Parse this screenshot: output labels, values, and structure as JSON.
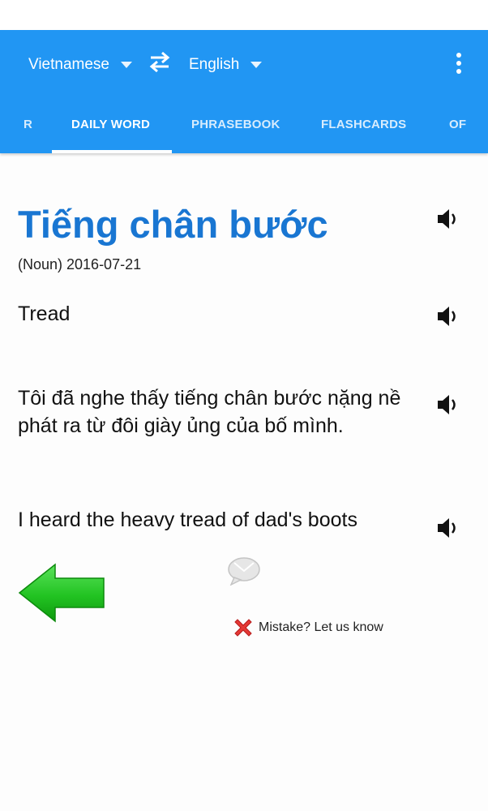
{
  "toolbar": {
    "source_language": "Vietnamese",
    "target_language": "English",
    "swap_icon": "swap-arrows-icon",
    "more_icon": "more-vertical-icon"
  },
  "tabs": [
    {
      "label": "R",
      "active": false
    },
    {
      "label": "DAILY WORD",
      "active": true
    },
    {
      "label": "PHRASEBOOK",
      "active": false
    },
    {
      "label": "FLASHCARDS",
      "active": false
    },
    {
      "label": "OF",
      "active": false
    }
  ],
  "daily_word": {
    "word": "Tiếng chân bước",
    "meta": "(Noun) 2016-07-21",
    "translation": "Tread",
    "example": "Tôi đã nghe thấy tiếng chân bước nặng nề phát ra từ đôi giày ủng của bố mình.",
    "example_translation": "I heard the heavy tread of dad's boots"
  },
  "actions": {
    "back_icon": "green-back-arrow-icon",
    "comment_icon": "comment-bubble-icon",
    "mistake_label": "Mistake? Let us know",
    "mistake_icon": "red-x-icon"
  },
  "colors": {
    "app_bar": "#2196F3",
    "title": "#1976D2",
    "back_arrow": "#22C322",
    "mistake_x": "#E53935"
  }
}
